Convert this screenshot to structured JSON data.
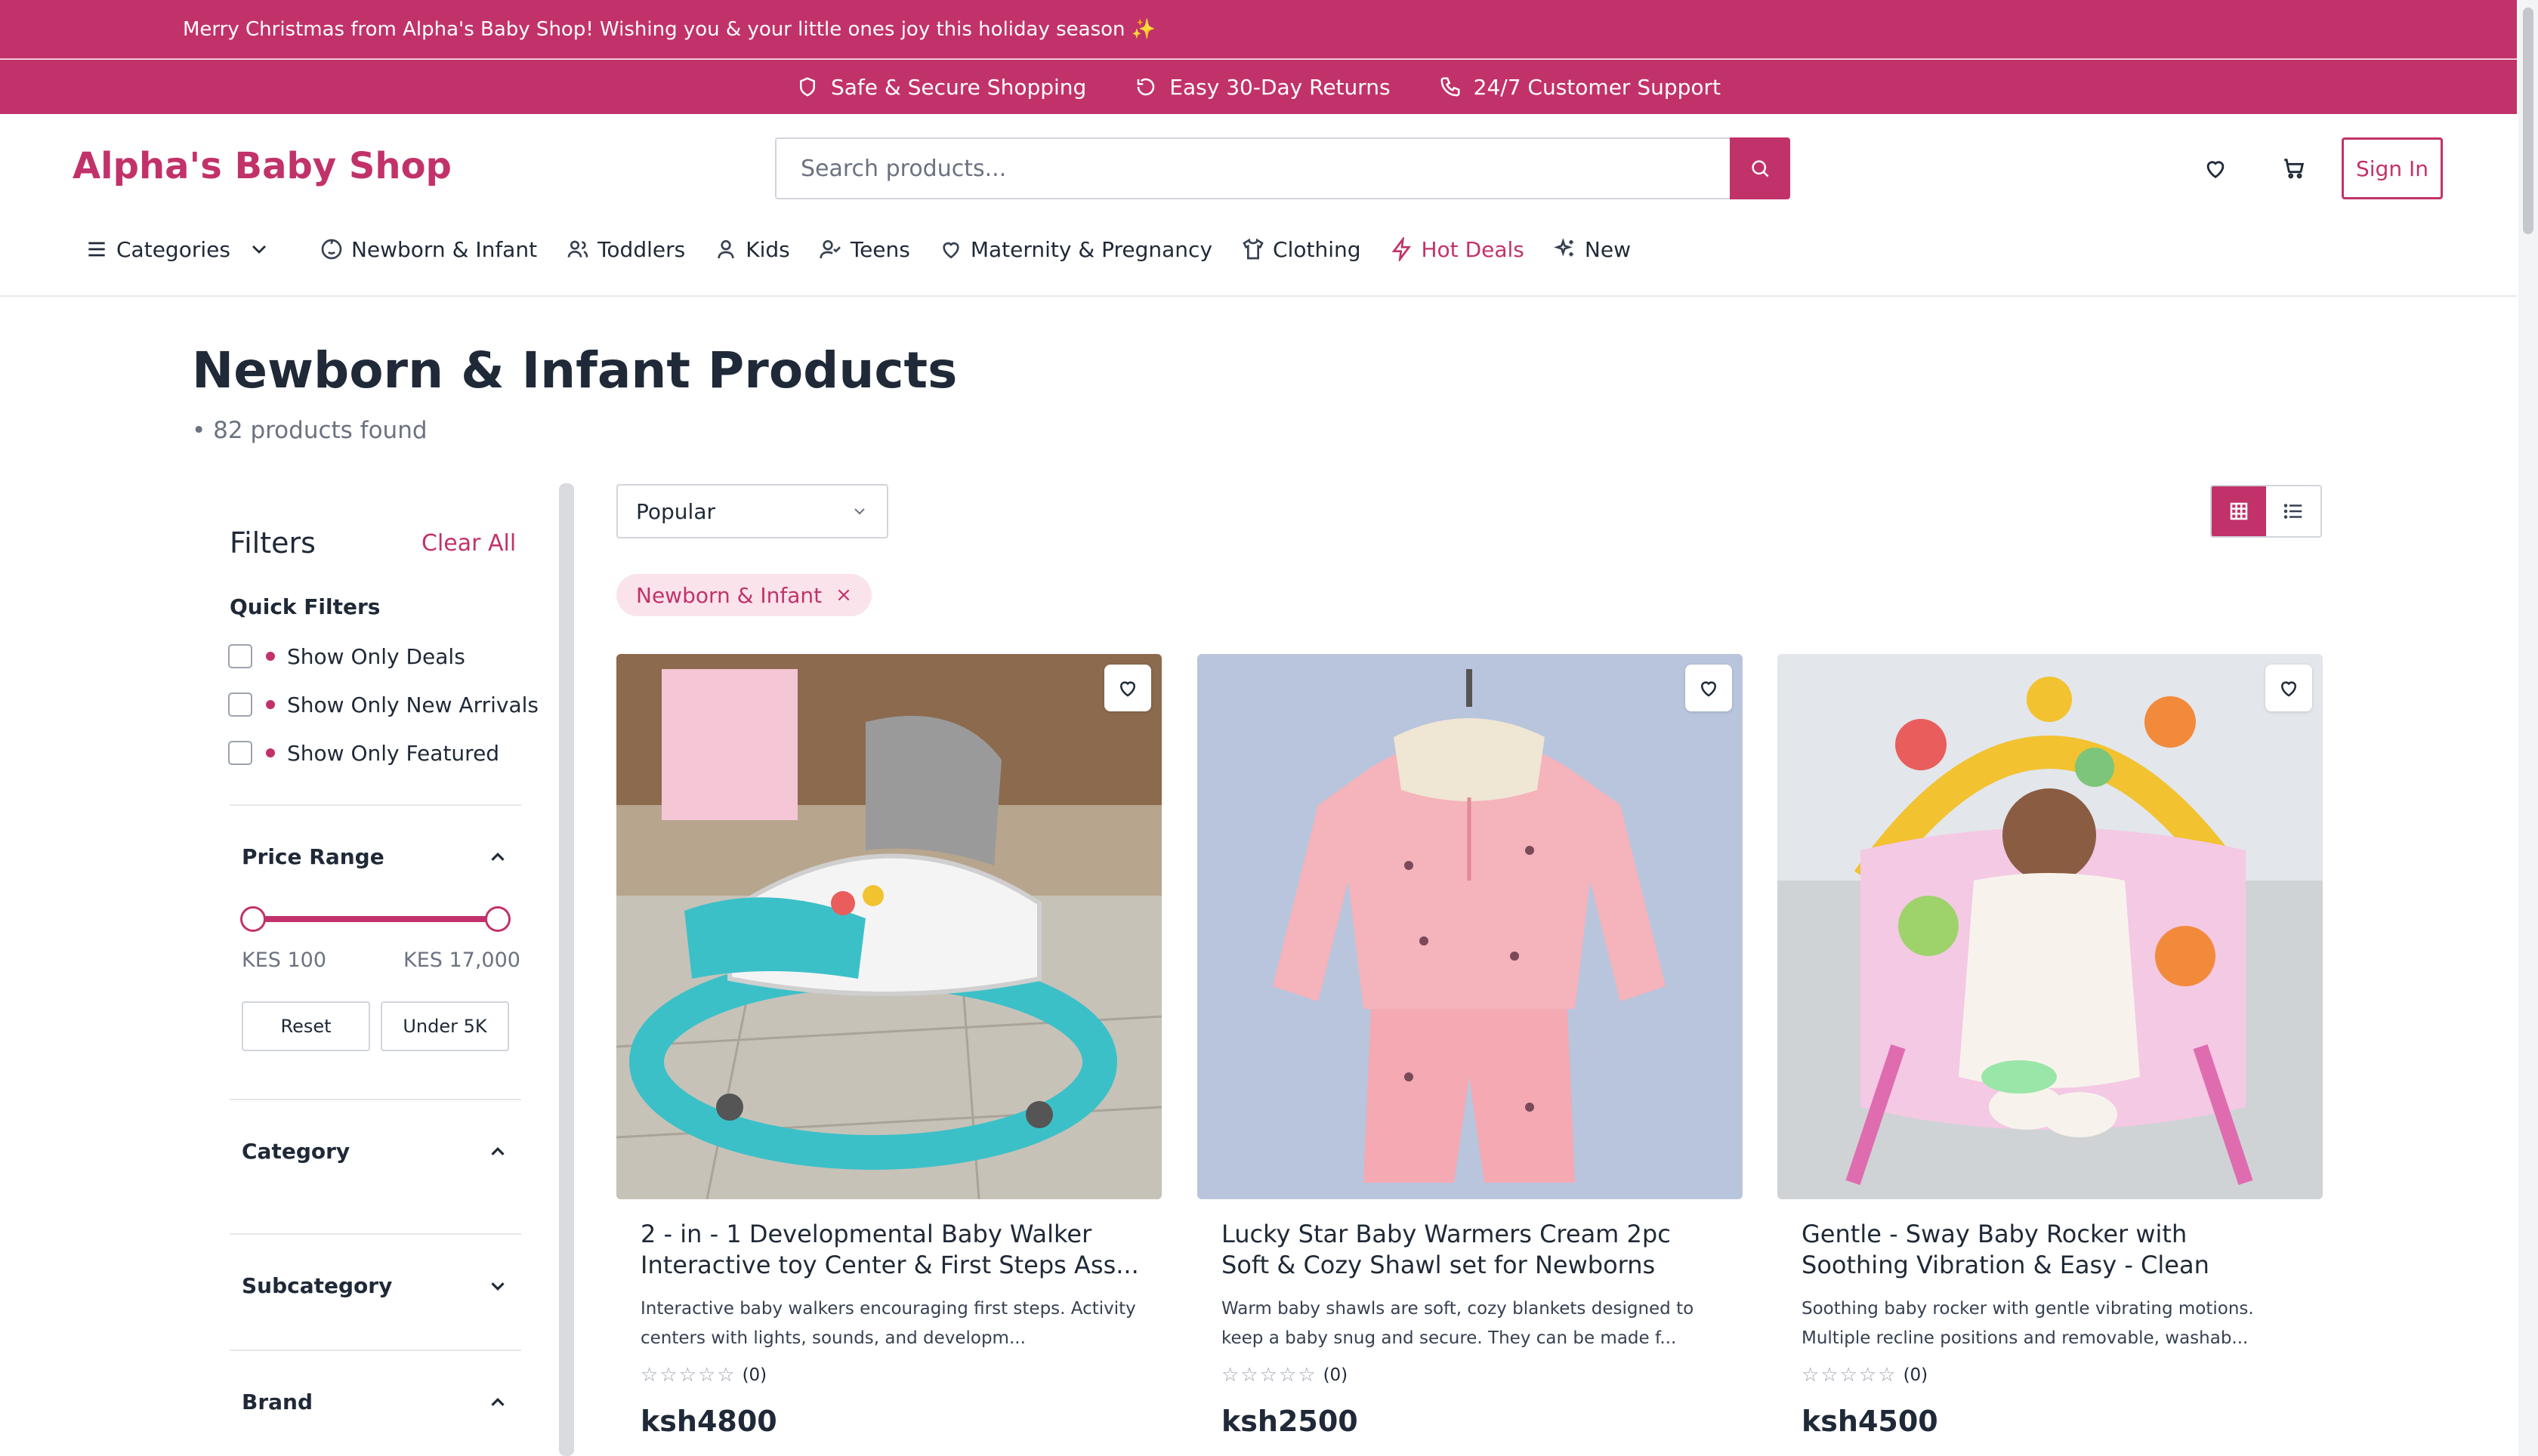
{
  "promo": {
    "text": "Merry Christmas from Alpha's Baby Shop! Wishing you & your little ones joy this holiday season ✨"
  },
  "trust": [
    {
      "icon": "shield-icon",
      "label": "Safe & Secure Shopping"
    },
    {
      "icon": "return-icon",
      "label": "Easy 30-Day Returns"
    },
    {
      "icon": "phone-icon",
      "label": "24/7 Customer Support"
    }
  ],
  "header": {
    "logo": "Alpha's Baby Shop",
    "search_placeholder": "Search products...",
    "signin": "Sign In"
  },
  "nav": {
    "categories": "Categories",
    "items": [
      {
        "icon": "baby-face-icon",
        "label": "Newborn & Infant"
      },
      {
        "icon": "users-icon",
        "label": "Toddlers"
      },
      {
        "icon": "user-icon",
        "label": "Kids"
      },
      {
        "icon": "user-check-icon",
        "label": "Teens"
      },
      {
        "icon": "heart-icon",
        "label": "Maternity & Pregnancy"
      },
      {
        "icon": "shirt-icon",
        "label": "Clothing"
      },
      {
        "icon": "lightning-icon",
        "label": "Hot Deals"
      },
      {
        "icon": "sparkles-icon",
        "label": "New"
      }
    ]
  },
  "page": {
    "title": "Newborn & Infant Products",
    "count": "• 82 products found"
  },
  "filters": {
    "title": "Filters",
    "clear_all": "Clear All",
    "quick_title": "Quick Filters",
    "quick": [
      "Show Only Deals",
      "Show Only New Arrivals",
      "Show Only Featured"
    ],
    "price_title": "Price Range",
    "price_min": "KES 100",
    "price_max": "KES 17,000",
    "reset": "Reset",
    "under": "Under 5K",
    "category": "Category",
    "subcategory": "Subcategory",
    "brand": "Brand"
  },
  "toolbar": {
    "sort": "Popular",
    "chip": "Newborn & Infant"
  },
  "colors": {
    "accent": "#c2326a"
  },
  "products": [
    {
      "title": "2 - in - 1 Developmental Baby Walker Interactive toy Center & First Steps Ass...",
      "desc": "Interactive baby walkers encouraging first steps. Activity centers with lights, sounds, and developm...",
      "rating": "(0)",
      "price": "ksh4800"
    },
    {
      "title": "Lucky Star Baby Warmers Cream 2pc Soft & Cozy Shawl set for Newborns",
      "desc": "Warm baby shawls are soft, cozy blankets designed to keep a baby snug and secure. They can be made f...",
      "rating": "(0)",
      "price": "ksh2500"
    },
    {
      "title": "Gentle - Sway Baby Rocker with Soothing Vibration & Easy - Clean Design",
      "desc": "Soothing baby rocker with gentle vibrating motions. Multiple recline positions and removable, washab...",
      "rating": "(0)",
      "price": "ksh4500"
    }
  ]
}
